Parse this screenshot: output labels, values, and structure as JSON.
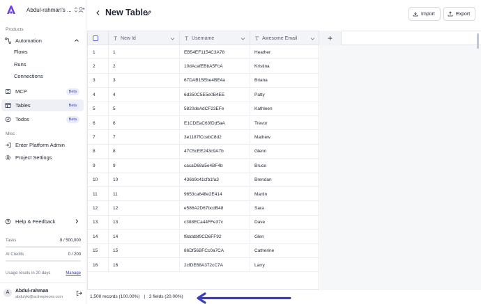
{
  "workspace": {
    "name": "Abdul-rahman's ..."
  },
  "sidebar": {
    "products_label": "Products",
    "automation": {
      "label": "Automation",
      "children": [
        "Flows",
        "Runs",
        "Connections"
      ]
    },
    "items": [
      {
        "label": "MCP",
        "badge": "Beta",
        "icon": "mcp-icon"
      },
      {
        "label": "Tables",
        "badge": "Beta",
        "icon": "table-icon",
        "active": true
      },
      {
        "label": "Todos",
        "badge": "Beta",
        "icon": "todo-icon"
      }
    ],
    "misc_label": "Misc",
    "misc_items": [
      {
        "label": "Enter Platform Admin",
        "icon": "admin-icon"
      },
      {
        "label": "Project Settings",
        "icon": "gear-icon"
      }
    ],
    "help": {
      "label": "Help & Feedback"
    },
    "usage": {
      "tasks_label": "Tasks",
      "tasks_value": "8 / 500,000",
      "tasks_fraction": 1.6e-05,
      "credits_label": "AI Credits",
      "credits_value": "0 / 200",
      "credits_fraction": 0,
      "reset_text": "Usage resets in 20 days",
      "manage_label": "Manage"
    },
    "account": {
      "initial": "A",
      "name": "Abdul-rahman",
      "email": "abdulyki@activepieces.com"
    }
  },
  "header": {
    "title": "New Table",
    "import_label": "Import",
    "export_label": "Export"
  },
  "table": {
    "columns": [
      "New Id",
      "Username",
      "Awesome Email"
    ],
    "add_column_label": "+",
    "rows": [
      {
        "n": "1",
        "id": "1",
        "username": "EB54EF1154C3A78",
        "email": "Heather"
      },
      {
        "n": "2",
        "id": "2",
        "username": "10dAcafEBbA5FcA",
        "email": "Kristina"
      },
      {
        "n": "3",
        "id": "3",
        "username": "67DAB15Ebe4BE4a",
        "email": "Briana"
      },
      {
        "n": "4",
        "id": "4",
        "username": "6d350C5E5e0B4EE",
        "email": "Patty"
      },
      {
        "n": "5",
        "id": "5",
        "username": "5820deAdCF23EFe",
        "email": "Kathleen"
      },
      {
        "n": "6",
        "id": "6",
        "username": "E1CDEaC63fDd5aA",
        "email": "Trevor"
      },
      {
        "n": "7",
        "id": "7",
        "username": "3e1187fCcebC8d2",
        "email": "Mathew"
      },
      {
        "n": "8",
        "id": "8",
        "username": "47C5cEE243c9A7b",
        "email": "Glenn"
      },
      {
        "n": "9",
        "id": "9",
        "username": "cacaD68a5e4BF4b",
        "email": "Bruce"
      },
      {
        "n": "10",
        "id": "10",
        "username": "436b9c41cfb1fa3",
        "email": "Brendan"
      },
      {
        "n": "11",
        "id": "11",
        "username": "9653ca648e2E414",
        "email": "Martin"
      },
      {
        "n": "12",
        "id": "12",
        "username": "e586A2D67bcdB48",
        "email": "Sara"
      },
      {
        "n": "13",
        "id": "13",
        "username": "c388ECa44FFe37c",
        "email": "Dave"
      },
      {
        "n": "14",
        "id": "14",
        "username": "f8dddbf9CD6FF92",
        "email": "Glen"
      },
      {
        "n": "15",
        "id": "15",
        "username": "86Df56BFCc0a7CA",
        "email": "Catherine"
      },
      {
        "n": "16",
        "id": "16",
        "username": "2cfDE68A372cC7A",
        "email": "Larry"
      }
    ]
  },
  "footer": {
    "records": "1,500 records (100.00%)",
    "separator": "|",
    "fields": "3 fields (20.00%)"
  },
  "colors": {
    "brand": "#6e41e2",
    "active_bg": "#eef0f6",
    "badge_bg": "#e8ebfa",
    "badge_text": "#3b43b5",
    "arrow": "#3b3fb8"
  }
}
